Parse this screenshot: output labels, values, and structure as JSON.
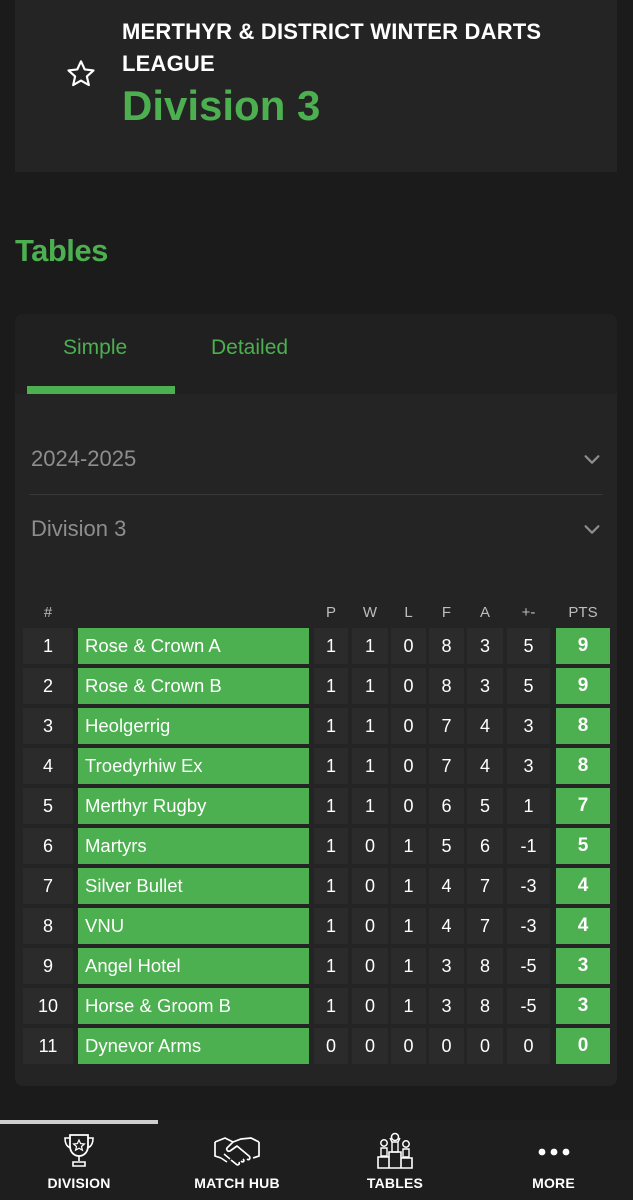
{
  "header": {
    "league_name": "MERTHYR & DISTRICT WINTER DARTS LEAGUE",
    "division_title": "Division 3",
    "favorite_icon": "star-outline-icon"
  },
  "section_title": "Tables",
  "tabs": [
    {
      "label": "Simple",
      "active": true
    },
    {
      "label": "Detailed",
      "active": false
    }
  ],
  "filters": {
    "season": "2024-2025",
    "division": "Division 3"
  },
  "table": {
    "columns": [
      "#",
      "P",
      "W",
      "L",
      "F",
      "A",
      "+-",
      "PTS"
    ],
    "rows": [
      {
        "pos": "1",
        "team": "Rose & Crown A",
        "p": "1",
        "w": "1",
        "l": "0",
        "f": "8",
        "a": "3",
        "gd": "5",
        "pts": "9"
      },
      {
        "pos": "2",
        "team": "Rose & Crown B",
        "p": "1",
        "w": "1",
        "l": "0",
        "f": "8",
        "a": "3",
        "gd": "5",
        "pts": "9"
      },
      {
        "pos": "3",
        "team": "Heolgerrig",
        "p": "1",
        "w": "1",
        "l": "0",
        "f": "7",
        "a": "4",
        "gd": "3",
        "pts": "8"
      },
      {
        "pos": "4",
        "team": "Troedyrhiw Ex",
        "p": "1",
        "w": "1",
        "l": "0",
        "f": "7",
        "a": "4",
        "gd": "3",
        "pts": "8"
      },
      {
        "pos": "5",
        "team": "Merthyr Rugby",
        "p": "1",
        "w": "1",
        "l": "0",
        "f": "6",
        "a": "5",
        "gd": "1",
        "pts": "7"
      },
      {
        "pos": "6",
        "team": "Martyrs",
        "p": "1",
        "w": "0",
        "l": "1",
        "f": "5",
        "a": "6",
        "gd": "-1",
        "pts": "5"
      },
      {
        "pos": "7",
        "team": "Silver Bullet",
        "p": "1",
        "w": "0",
        "l": "1",
        "f": "4",
        "a": "7",
        "gd": "-3",
        "pts": "4"
      },
      {
        "pos": "8",
        "team": "VNU",
        "p": "1",
        "w": "0",
        "l": "1",
        "f": "4",
        "a": "7",
        "gd": "-3",
        "pts": "4"
      },
      {
        "pos": "9",
        "team": "Angel Hotel",
        "p": "1",
        "w": "0",
        "l": "1",
        "f": "3",
        "a": "8",
        "gd": "-5",
        "pts": "3"
      },
      {
        "pos": "10",
        "team": "Horse & Groom B",
        "p": "1",
        "w": "0",
        "l": "1",
        "f": "3",
        "a": "8",
        "gd": "-5",
        "pts": "3"
      },
      {
        "pos": "11",
        "team": "Dynevor Arms",
        "p": "0",
        "w": "0",
        "l": "0",
        "f": "0",
        "a": "0",
        "gd": "0",
        "pts": "0"
      }
    ]
  },
  "bottom_nav": [
    {
      "label": "DIVISION",
      "icon": "trophy-icon",
      "active": true
    },
    {
      "label": "MATCH HUB",
      "icon": "handshake-icon",
      "active": false
    },
    {
      "label": "TABLES",
      "icon": "podium-icon",
      "active": false
    },
    {
      "label": "MORE",
      "icon": "more-dots-icon",
      "active": false
    }
  ],
  "colors": {
    "accent": "#4caf50",
    "background": "#1b1b1b",
    "card": "#242424",
    "cell": "#2b2b2b"
  }
}
